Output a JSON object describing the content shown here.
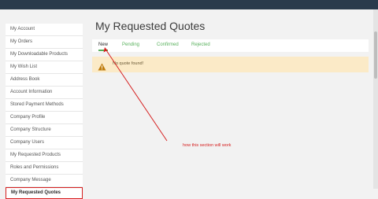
{
  "sidebar": {
    "items": [
      {
        "label": "My Account"
      },
      {
        "label": "My Orders"
      },
      {
        "label": "My Downloadable Products"
      },
      {
        "label": "My Wish List"
      },
      {
        "label": "Address Book"
      },
      {
        "label": "Account Information"
      },
      {
        "label": "Stored Payment Methods"
      },
      {
        "label": "Company Profile"
      },
      {
        "label": "Company Structure"
      },
      {
        "label": "Company Users"
      },
      {
        "label": "My Requested Products"
      },
      {
        "label": "Roles and Permissions"
      },
      {
        "label": "Company Message"
      },
      {
        "label": "My Requested Quotes"
      }
    ],
    "active_index": 13
  },
  "main": {
    "title": "My Requested Quotes",
    "tabs": [
      {
        "label": "New"
      },
      {
        "label": "Pending"
      },
      {
        "label": "Confirmed"
      },
      {
        "label": "Rejected"
      }
    ],
    "selected_tab": "New",
    "notice": {
      "text": "No quote found!",
      "icon": "warning-icon"
    }
  },
  "annotation": {
    "text": "how this section will work"
  },
  "colors": {
    "accent": "#58b05c",
    "annotation": "#d62020",
    "notice_bg": "#fbeac7",
    "header_bg": "#2a3b4c"
  }
}
